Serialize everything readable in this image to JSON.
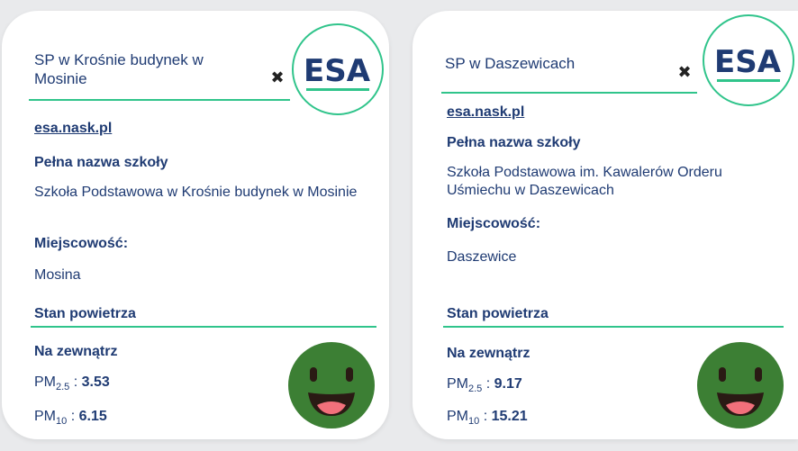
{
  "logo_text": "ESA",
  "colors": {
    "accent": "#30c48b",
    "text": "#1f3b73",
    "face": "#3c7f34",
    "mouth": "#2a1a14",
    "tongue": "#f2707b"
  },
  "cards": [
    {
      "title": "SP w Krośnie budynek w Mosinie",
      "link": "esa.nask.pl",
      "full_name_label": "Pełna nazwa szkoły",
      "full_name": "Szkoła Podstawowa w Krośnie budynek w Mosinie",
      "city_label": "Miejscowość:",
      "city": "Mosina",
      "air_label": "Stan powietrza",
      "outside_label": "Na zewnątrz",
      "pm25_label": "PM",
      "pm25_sub": "2.5",
      "pm25_value": "3.53",
      "pm10_label": "PM",
      "pm10_sub": "10",
      "pm10_value": "6.15",
      "close_glyph": "✖"
    },
    {
      "title": "SP w Daszewicach",
      "link": "esa.nask.pl",
      "full_name_label": "Pełna nazwa szkoły",
      "full_name": "Szkoła Podstawowa im. Kawalerów Orderu Uśmiechu w Daszewicach",
      "city_label": "Miejscowość:",
      "city": "Daszewice",
      "air_label": "Stan powietrza",
      "outside_label": "Na zewnątrz",
      "pm25_label": "PM",
      "pm25_sub": "2.5",
      "pm25_value": "9.17",
      "pm10_label": "PM",
      "pm10_sub": "10",
      "pm10_value": "15.21",
      "close_glyph": "✖"
    }
  ]
}
